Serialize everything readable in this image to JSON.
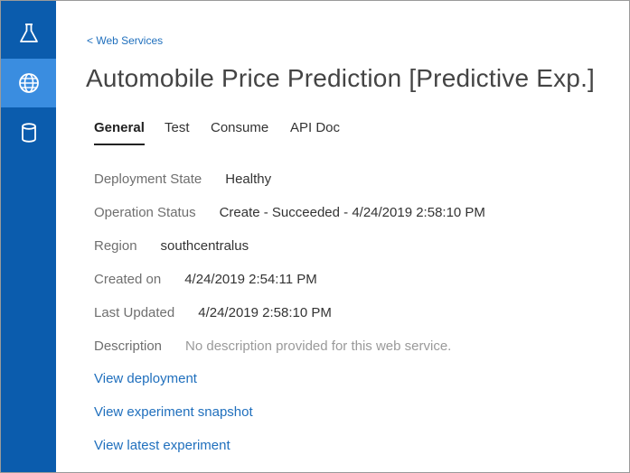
{
  "sidebar": {
    "items": [
      {
        "icon": "flask-icon",
        "active": false
      },
      {
        "icon": "globe-icon",
        "active": true
      },
      {
        "icon": "database-icon",
        "active": false
      }
    ]
  },
  "breadcrumb": "< Web Services",
  "title": "Automobile Price Prediction [Predictive Exp.]",
  "tabs": [
    {
      "label": "General",
      "active": true
    },
    {
      "label": "Test",
      "active": false
    },
    {
      "label": "Consume",
      "active": false
    },
    {
      "label": "API Doc",
      "active": false
    }
  ],
  "details": {
    "deployment_state": {
      "label": "Deployment State",
      "value": "Healthy"
    },
    "operation_status": {
      "label": "Operation Status",
      "value": "Create - Succeeded - 4/24/2019 2:58:10 PM"
    },
    "region": {
      "label": "Region",
      "value": "southcentralus"
    },
    "created_on": {
      "label": "Created on",
      "value": "4/24/2019 2:54:11 PM"
    },
    "last_updated": {
      "label": "Last Updated",
      "value": "4/24/2019 2:58:10 PM"
    },
    "description": {
      "label": "Description",
      "value": "No description provided for this web service."
    }
  },
  "links": {
    "view_deployment": "View deployment",
    "view_snapshot": "View experiment snapshot",
    "view_latest": "View latest experiment"
  },
  "colors": {
    "sidebar": "#0b5cad",
    "sidebar_active": "#3a8de0",
    "link": "#1f6fbd"
  }
}
